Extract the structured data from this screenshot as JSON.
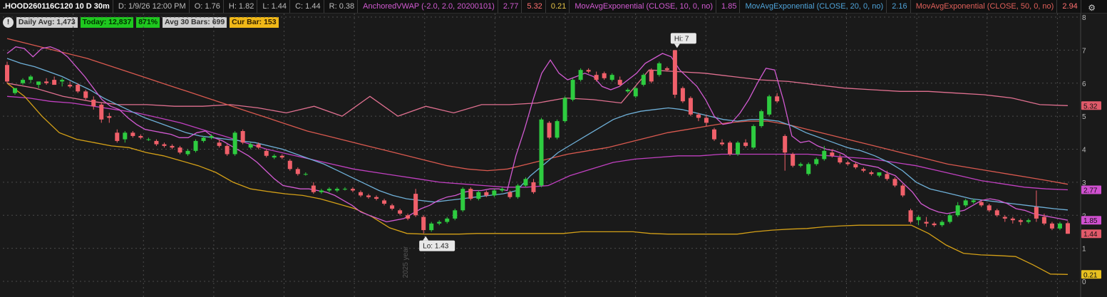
{
  "header": {
    "symbol": ".HOOD260116C120 10 D 30m",
    "date": "D: 1/9/26 12:00 PM",
    "open": "O: 1.76",
    "high": "H: 1.82",
    "low": "L: 1.44",
    "close": "C: 1.44",
    "range": "R: 0.38",
    "vwap_name": "AnchoredVWAP (-2.0, 2.0, 20200101)",
    "vwap_v1": "2.77",
    "vwap_v2": "5.32",
    "vwap_v3": "0.21",
    "ema10_name": "MovAvgExponential (CLOSE, 10, 0, no)",
    "ema10_val": "1.85",
    "ema20_name": "MovAvgExponential (CLOSE, 20, 0, no)",
    "ema20_val": "2.16",
    "ema50_name": "MovAvgExponential (CLOSE, 50, 0, no)",
    "ema50_val": "2.94"
  },
  "badges": {
    "warn": "!",
    "daily_avg": "Daily Avg: 1,473",
    "today": "Today: 12,837",
    "pct": "871%",
    "avg30": "Avg 30 Bars: 699",
    "cur_bar": "Cur Bar: 153"
  },
  "colors": {
    "up": "#2ecc40",
    "down": "#f0606a",
    "ema10": "#d15ad1",
    "ema20": "#6fb0d8",
    "ema50": "#d9594f",
    "vwap": "#c040c0",
    "band_low": "#d4a017",
    "band_high": "#e07090"
  },
  "chart_data": {
    "type": "candlestick",
    "y_ticks": [
      "8",
      "7",
      "6",
      "5",
      "4",
      "3",
      "2",
      "1",
      "0"
    ],
    "ylim": [
      0,
      8
    ],
    "price_labels": [
      {
        "text": "5.32",
        "value": 5.32,
        "bg": "#e05a6a"
      },
      {
        "text": "2.77",
        "value": 2.77,
        "bg": "#d050d0"
      },
      {
        "text": "1.85",
        "value": 1.85,
        "bg": "#d050d0"
      },
      {
        "text": "1.44",
        "value": 1.44,
        "bg": "#e05a6a"
      },
      {
        "text": "0.21",
        "value": 0.21,
        "bg": "#e8c020"
      }
    ],
    "annotations": {
      "hi": "Hi: 7",
      "lo": "Lo: 1.43",
      "year_label": "2025 year"
    },
    "candles": [
      [
        6.55,
        6.65,
        6.0,
        6.05
      ],
      [
        5.7,
        5.85,
        5.65,
        5.85
      ],
      [
        6.0,
        6.15,
        5.95,
        6.1
      ],
      [
        6.1,
        6.25,
        6.0,
        6.2
      ],
      [
        5.95,
        6.05,
        5.85,
        6.05
      ],
      [
        6.05,
        6.15,
        5.95,
        6.0
      ],
      [
        6.1,
        6.2,
        5.95,
        5.95
      ],
      [
        6.05,
        6.15,
        5.9,
        6.1
      ],
      [
        5.95,
        6.05,
        5.85,
        5.9
      ],
      [
        5.95,
        6.0,
        5.7,
        5.75
      ],
      [
        5.75,
        5.8,
        5.5,
        5.55
      ],
      [
        5.5,
        5.6,
        5.2,
        5.3
      ],
      [
        5.35,
        5.4,
        4.8,
        4.9
      ],
      [
        5.0,
        5.1,
        4.8,
        4.95
      ],
      [
        4.5,
        4.6,
        4.2,
        4.25
      ],
      [
        4.3,
        4.55,
        4.2,
        4.5
      ],
      [
        4.5,
        4.55,
        4.35,
        4.4
      ],
      [
        4.4,
        4.45,
        4.3,
        4.35
      ],
      [
        4.3,
        4.35,
        4.25,
        4.3
      ],
      [
        4.25,
        4.3,
        4.1,
        4.15
      ],
      [
        4.15,
        4.2,
        4.05,
        4.1
      ],
      [
        4.1,
        4.15,
        4.0,
        4.05
      ],
      [
        4.05,
        4.1,
        3.85,
        3.9
      ],
      [
        3.85,
        4.0,
        3.8,
        3.95
      ],
      [
        3.95,
        4.3,
        3.9,
        4.25
      ],
      [
        4.25,
        4.4,
        4.2,
        4.35
      ],
      [
        4.35,
        4.45,
        4.3,
        4.4
      ],
      [
        4.2,
        4.3,
        4.05,
        4.1
      ],
      [
        4.1,
        4.15,
        3.8,
        3.85
      ],
      [
        3.85,
        4.55,
        3.8,
        4.5
      ],
      [
        4.55,
        4.6,
        4.15,
        4.2
      ],
      [
        4.05,
        4.2,
        4.0,
        4.15
      ],
      [
        4.15,
        4.2,
        4.0,
        4.05
      ],
      [
        3.95,
        4.0,
        3.75,
        3.8
      ],
      [
        3.75,
        3.85,
        3.7,
        3.8
      ],
      [
        3.8,
        3.85,
        3.7,
        3.75
      ],
      [
        3.65,
        3.7,
        3.35,
        3.4
      ],
      [
        3.4,
        3.45,
        3.2,
        3.25
      ],
      [
        3.25,
        3.3,
        3.2,
        3.25
      ],
      [
        2.9,
        3.0,
        2.65,
        2.7
      ],
      [
        2.7,
        2.8,
        2.65,
        2.75
      ],
      [
        2.75,
        2.85,
        2.7,
        2.8
      ],
      [
        2.75,
        2.85,
        2.7,
        2.8
      ],
      [
        2.8,
        2.85,
        2.75,
        2.8
      ],
      [
        2.8,
        2.85,
        2.7,
        2.75
      ],
      [
        2.7,
        2.75,
        2.55,
        2.6
      ],
      [
        2.6,
        2.65,
        2.5,
        2.55
      ],
      [
        2.55,
        2.6,
        2.45,
        2.5
      ],
      [
        2.45,
        2.5,
        2.3,
        2.35
      ],
      [
        2.3,
        2.35,
        2.15,
        2.2
      ],
      [
        2.15,
        2.2,
        2.0,
        2.05
      ],
      [
        2.0,
        2.05,
        1.85,
        1.9
      ],
      [
        2.65,
        2.8,
        1.95,
        2.0
      ],
      [
        1.95,
        2.0,
        1.45,
        1.55
      ],
      [
        1.55,
        1.8,
        1.5,
        1.75
      ],
      [
        1.75,
        1.85,
        1.7,
        1.8
      ],
      [
        1.8,
        1.95,
        1.75,
        1.9
      ],
      [
        1.9,
        2.2,
        1.85,
        2.15
      ],
      [
        2.15,
        2.85,
        2.1,
        2.8
      ],
      [
        2.8,
        2.85,
        2.45,
        2.5
      ],
      [
        2.5,
        2.75,
        2.45,
        2.7
      ],
      [
        2.7,
        2.75,
        2.55,
        2.6
      ],
      [
        2.6,
        2.8,
        2.55,
        2.75
      ],
      [
        2.75,
        2.85,
        2.7,
        2.8
      ],
      [
        2.7,
        2.75,
        2.5,
        2.55
      ],
      [
        2.55,
        2.95,
        2.5,
        2.9
      ],
      [
        2.9,
        3.15,
        2.85,
        3.1
      ],
      [
        3.0,
        3.1,
        2.65,
        2.7
      ],
      [
        2.9,
        4.95,
        2.85,
        4.9
      ],
      [
        4.8,
        4.85,
        4.3,
        4.35
      ],
      [
        4.35,
        4.9,
        4.3,
        4.85
      ],
      [
        4.85,
        5.6,
        4.8,
        5.55
      ],
      [
        5.5,
        6.15,
        5.45,
        6.1
      ],
      [
        6.1,
        6.45,
        6.05,
        6.4
      ],
      [
        6.4,
        6.45,
        6.3,
        6.35
      ],
      [
        6.25,
        6.35,
        6.05,
        6.1
      ],
      [
        6.3,
        6.35,
        6.1,
        6.15
      ],
      [
        6.1,
        6.3,
        6.05,
        6.25
      ],
      [
        6.1,
        6.2,
        5.9,
        5.95
      ],
      [
        5.75,
        5.85,
        5.7,
        5.8
      ],
      [
        5.6,
        5.9,
        5.55,
        5.85
      ],
      [
        5.95,
        6.3,
        5.9,
        6.25
      ],
      [
        6.4,
        6.45,
        6.0,
        6.05
      ],
      [
        6.25,
        6.65,
        6.2,
        6.6
      ],
      [
        6.45,
        6.5,
        6.35,
        6.4
      ],
      [
        7.0,
        7.0,
        5.55,
        5.65
      ],
      [
        5.85,
        5.9,
        5.4,
        5.45
      ],
      [
        5.55,
        5.6,
        5.0,
        5.05
      ],
      [
        5.05,
        5.1,
        4.85,
        4.95
      ],
      [
        4.95,
        5.05,
        4.7,
        4.8
      ],
      [
        4.6,
        4.65,
        4.25,
        4.3
      ],
      [
        4.2,
        4.3,
        4.1,
        4.15
      ],
      [
        4.2,
        4.25,
        3.8,
        3.85
      ],
      [
        3.85,
        4.25,
        3.8,
        4.2
      ],
      [
        4.2,
        4.3,
        4.05,
        4.1
      ],
      [
        4.05,
        4.75,
        4.0,
        4.7
      ],
      [
        4.7,
        5.2,
        4.65,
        5.15
      ],
      [
        5.05,
        5.65,
        5.0,
        5.6
      ],
      [
        5.6,
        5.7,
        5.4,
        5.45
      ],
      [
        4.4,
        4.45,
        3.35,
        3.9
      ],
      [
        3.85,
        3.9,
        3.45,
        3.5
      ],
      [
        3.5,
        3.6,
        3.45,
        3.55
      ],
      [
        3.25,
        3.6,
        3.2,
        3.55
      ],
      [
        3.55,
        3.75,
        3.5,
        3.7
      ],
      [
        3.7,
        4.1,
        3.65,
        3.95
      ],
      [
        3.9,
        4.0,
        3.75,
        3.8
      ],
      [
        3.75,
        3.85,
        3.55,
        3.6
      ],
      [
        3.6,
        3.65,
        3.5,
        3.55
      ],
      [
        3.55,
        3.6,
        3.4,
        3.45
      ],
      [
        3.4,
        3.45,
        3.3,
        3.35
      ],
      [
        3.3,
        3.35,
        3.2,
        3.25
      ],
      [
        3.2,
        3.3,
        3.15,
        3.3
      ],
      [
        3.25,
        3.35,
        3.05,
        3.1
      ],
      [
        3.1,
        3.15,
        2.85,
        2.9
      ],
      [
        2.9,
        2.95,
        2.55,
        2.6
      ],
      [
        2.15,
        2.2,
        1.75,
        1.8
      ],
      [
        1.85,
        2.0,
        1.7,
        1.95
      ],
      [
        1.8,
        1.95,
        1.65,
        1.75
      ],
      [
        1.75,
        1.8,
        1.65,
        1.7
      ],
      [
        1.7,
        1.85,
        1.65,
        1.8
      ],
      [
        1.8,
        2.05,
        1.75,
        2.0
      ],
      [
        2.0,
        2.4,
        1.95,
        2.3
      ],
      [
        2.3,
        2.5,
        2.25,
        2.45
      ],
      [
        2.4,
        2.5,
        2.35,
        2.45
      ],
      [
        2.4,
        2.45,
        2.25,
        2.3
      ],
      [
        2.3,
        2.35,
        2.1,
        2.15
      ],
      [
        2.15,
        2.2,
        1.95,
        2.0
      ],
      [
        1.95,
        2.0,
        1.8,
        1.9
      ],
      [
        1.9,
        1.95,
        1.75,
        1.85
      ],
      [
        1.85,
        1.9,
        1.7,
        1.8
      ],
      [
        1.8,
        1.9,
        1.75,
        1.85
      ],
      [
        2.25,
        2.75,
        1.8,
        1.9
      ],
      [
        1.95,
        2.05,
        1.7,
        1.75
      ],
      [
        1.75,
        1.8,
        1.55,
        1.6
      ],
      [
        1.6,
        1.8,
        1.55,
        1.75
      ],
      [
        1.76,
        1.82,
        1.44,
        1.44
      ]
    ],
    "ema10": [
      6.9,
      7.1,
      7.05,
      6.8,
      7.05,
      7.1,
      7.0,
      6.8,
      6.5,
      6.2,
      5.85,
      5.5,
      5.3,
      5.2,
      4.95,
      4.75,
      4.6,
      4.55,
      4.5,
      4.45,
      4.35,
      4.35,
      4.5,
      4.55,
      4.35,
      4.25,
      4.1,
      3.95,
      3.8,
      3.6,
      3.35,
      3.1,
      2.9,
      2.85,
      2.8,
      2.8,
      2.75,
      2.7,
      2.6,
      2.45,
      2.3,
      2.1,
      2.0,
      1.9,
      1.8,
      1.85,
      1.9,
      2.05,
      2.2,
      2.3,
      2.45,
      2.55,
      2.6,
      2.7,
      2.75,
      2.75,
      2.8,
      2.8,
      2.75,
      3.8,
      4.6,
      5.5,
      6.3,
      6.7,
      6.3,
      6.1,
      6.2,
      6.3,
      6.2,
      5.9,
      5.8,
      5.9,
      6.1,
      6.3,
      6.6,
      6.75,
      6.9,
      6.8,
      6.4,
      6.15,
      5.9,
      5.5,
      5.0,
      4.75,
      4.8,
      5.1,
      5.5,
      6.0,
      6.45,
      6.4,
      5.5,
      4.4,
      4.2,
      4.25,
      4.1,
      4.0,
      3.95,
      3.85,
      3.65,
      3.55,
      3.5,
      3.45,
      3.3,
      3.2,
      2.95,
      2.7,
      2.35,
      2.2,
      2.1,
      2.05,
      2.1,
      2.15,
      2.3,
      2.45,
      2.5,
      2.45,
      2.35,
      2.2,
      2.15,
      2.05,
      2.0,
      1.95,
      1.9,
      1.85
    ],
    "ema20": [
      6.75,
      6.6,
      6.5,
      6.35,
      6.2,
      6.0,
      5.8,
      5.55,
      5.35,
      5.15,
      4.95,
      4.8,
      4.65,
      4.5,
      4.4,
      4.35,
      4.3,
      4.25,
      4.2,
      4.1,
      4.0,
      3.85,
      3.7,
      3.55,
      3.35,
      3.15,
      2.95,
      2.75,
      2.6,
      2.5,
      2.45,
      2.4,
      2.45,
      2.5,
      2.55,
      2.6,
      2.65,
      2.75,
      3.2,
      3.55,
      3.9,
      4.15,
      4.4,
      4.65,
      4.9,
      5.05,
      5.15,
      5.2,
      5.25,
      5.2,
      5.1,
      5.0,
      4.9,
      4.85,
      4.9,
      4.9,
      4.85,
      4.7,
      4.5,
      4.35,
      4.2,
      4.05,
      3.95,
      3.8,
      3.6,
      3.35,
      3.0,
      2.8,
      2.7,
      2.6,
      2.5,
      2.45,
      2.4,
      2.35,
      2.3,
      2.25,
      2.2,
      2.16
    ],
    "ema50": [
      7.35,
      7.2,
      7.05,
      6.9,
      6.75,
      6.55,
      6.35,
      6.15,
      5.95,
      5.75,
      5.55,
      5.35,
      5.15,
      4.95,
      4.75,
      4.55,
      4.4,
      4.25,
      4.1,
      3.95,
      3.8,
      3.65,
      3.5,
      3.4,
      3.35,
      3.4,
      3.55,
      3.7,
      3.85,
      3.95,
      4.05,
      4.2,
      4.35,
      4.5,
      4.6,
      4.7,
      4.8,
      4.85,
      4.85,
      4.75,
      4.6,
      4.45,
      4.3,
      4.15,
      4.0,
      3.85,
      3.7,
      3.55,
      3.45,
      3.35,
      3.25,
      3.15,
      3.05,
      2.94
    ],
    "vwap_mid": [
      5.6,
      5.55,
      5.45,
      5.4,
      5.3,
      5.2,
      5.1,
      4.95,
      4.8,
      4.6,
      4.4,
      4.2,
      4.0,
      3.85,
      3.7,
      3.55,
      3.4,
      3.3,
      3.2,
      3.1,
      3.0,
      2.95,
      2.9,
      2.85,
      2.85,
      2.9,
      3.2,
      3.4,
      3.6,
      3.7,
      3.75,
      3.8,
      3.8,
      3.85,
      3.85,
      3.85,
      3.85,
      3.85,
      3.8,
      3.75,
      3.7,
      3.6,
      3.5,
      3.35,
      3.2,
      3.05,
      2.95,
      2.85,
      2.8,
      2.77
    ],
    "vwap_upper": [
      6.0,
      5.85,
      5.6,
      5.45,
      5.35,
      5.35,
      5.3,
      5.3,
      5.35,
      5.25,
      5.1,
      5.3,
      5.0,
      5.6,
      5.0,
      5.3,
      5.1,
      5.35,
      5.35,
      5.4,
      5.55,
      5.5,
      5.4,
      6.4,
      6.35,
      6.3,
      6.2,
      6.1,
      6.05,
      5.95,
      5.85,
      5.8,
      5.75,
      5.75,
      5.7,
      5.65,
      5.55,
      5.35,
      5.32
    ],
    "vwap_lower": [
      6.0,
      5.6,
      5.0,
      4.5,
      4.3,
      4.2,
      4.1,
      4.05,
      3.9,
      3.8,
      3.65,
      3.5,
      3.3,
      3.0,
      2.8,
      2.72,
      2.65,
      2.6,
      2.5,
      2.35,
      2.2,
      1.95,
      1.62,
      1.45,
      1.43,
      1.43,
      1.43,
      1.45,
      1.45,
      1.45,
      1.45,
      1.45,
      1.45,
      1.5,
      1.5,
      1.5,
      1.5,
      1.45,
      1.43,
      1.43,
      1.43,
      1.43,
      1.43,
      1.5,
      1.55,
      1.58,
      1.6,
      1.65,
      1.68,
      1.7,
      1.7,
      1.7,
      1.7,
      1.45,
      1.1,
      0.85,
      0.8,
      0.78,
      0.75,
      0.5,
      0.22,
      0.21
    ],
    "x_gridlines": 15
  }
}
